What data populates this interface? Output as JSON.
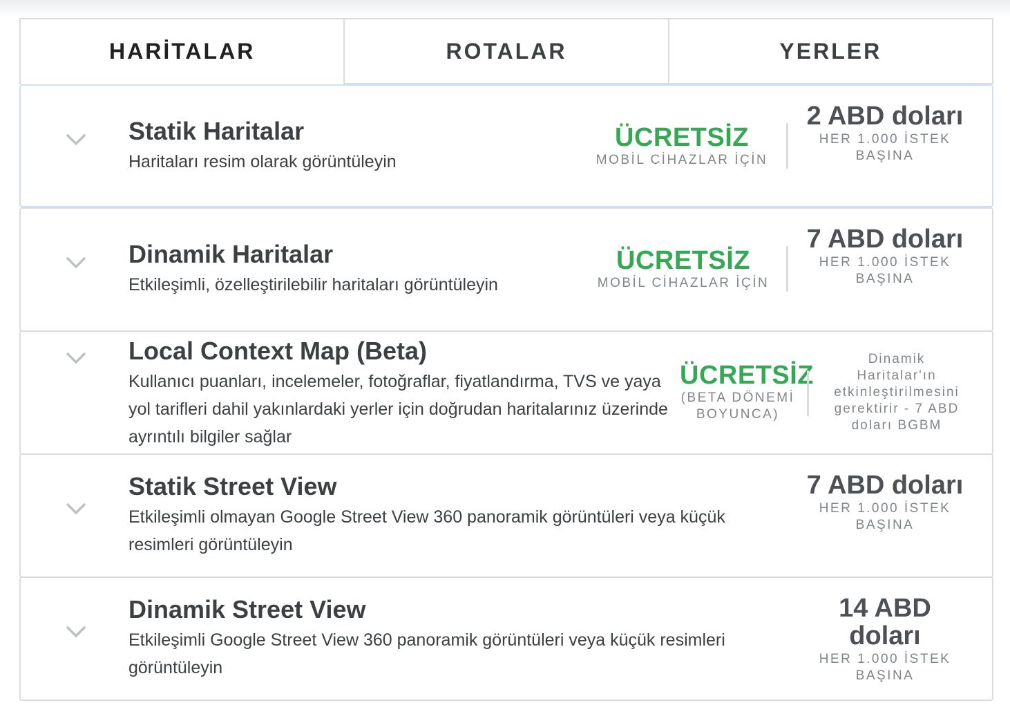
{
  "tabs": [
    {
      "label": "HARİTALAR",
      "active": true
    },
    {
      "label": "ROTALAR",
      "active": false
    },
    {
      "label": "YERLER",
      "active": false
    }
  ],
  "icons": {
    "expand": "chevron-down-icon"
  },
  "colors": {
    "free": "#34a853",
    "border": "#dadce0",
    "active_border": "#cfe0f3"
  },
  "rows": [
    {
      "title": "Statik Haritalar",
      "desc": "Haritaları resim olarak görüntüleyin",
      "free_label": "ÜCRETSİZ",
      "free_sub": "MOBİL CİHAZLAR İÇİN",
      "price_amount": "2 ABD doları",
      "price_unit": "HER 1.000 İSTEK BAŞINA"
    },
    {
      "title": "Dinamik Haritalar",
      "desc": "Etkileşimli, özelleştirilebilir haritaları görüntüleyin",
      "free_label": "ÜCRETSİZ",
      "free_sub": "MOBİL CİHAZLAR İÇİN",
      "price_amount": "7 ABD doları",
      "price_unit": "HER 1.000 İSTEK BAŞINA"
    },
    {
      "title": "Local Context Map (Beta)",
      "desc": "Kullanıcı puanları, incelemeler, fotoğraflar, fiyatlandırma, TVS ve yaya yol tarifleri dahil yakınlardaki yerler için doğrudan haritalarınız üzerinde ayrıntılı bilgiler sağlar",
      "free_label": "ÜCRETSİZ",
      "free_sub": "(BETA DÖNEMİ BOYUNCA)",
      "note": "Dinamik Haritalar'ın etkinleştirilmesini gerektirir - 7 ABD doları BGBM"
    },
    {
      "title": "Statik Street View",
      "desc": "Etkileşimli olmayan Google Street View 360 panoramik görüntüleri veya küçük resimleri görüntüleyin",
      "price_amount": "7 ABD doları",
      "price_unit": "HER 1.000 İSTEK BAŞINA"
    },
    {
      "title": "Dinamik Street View",
      "desc": "Etkileşimli Google Street View 360 panoramik görüntüleri veya küçük resimleri görüntüleyin",
      "price_amount": "14 ABD doları",
      "price_unit": "HER 1.000 İSTEK BAŞINA"
    }
  ]
}
